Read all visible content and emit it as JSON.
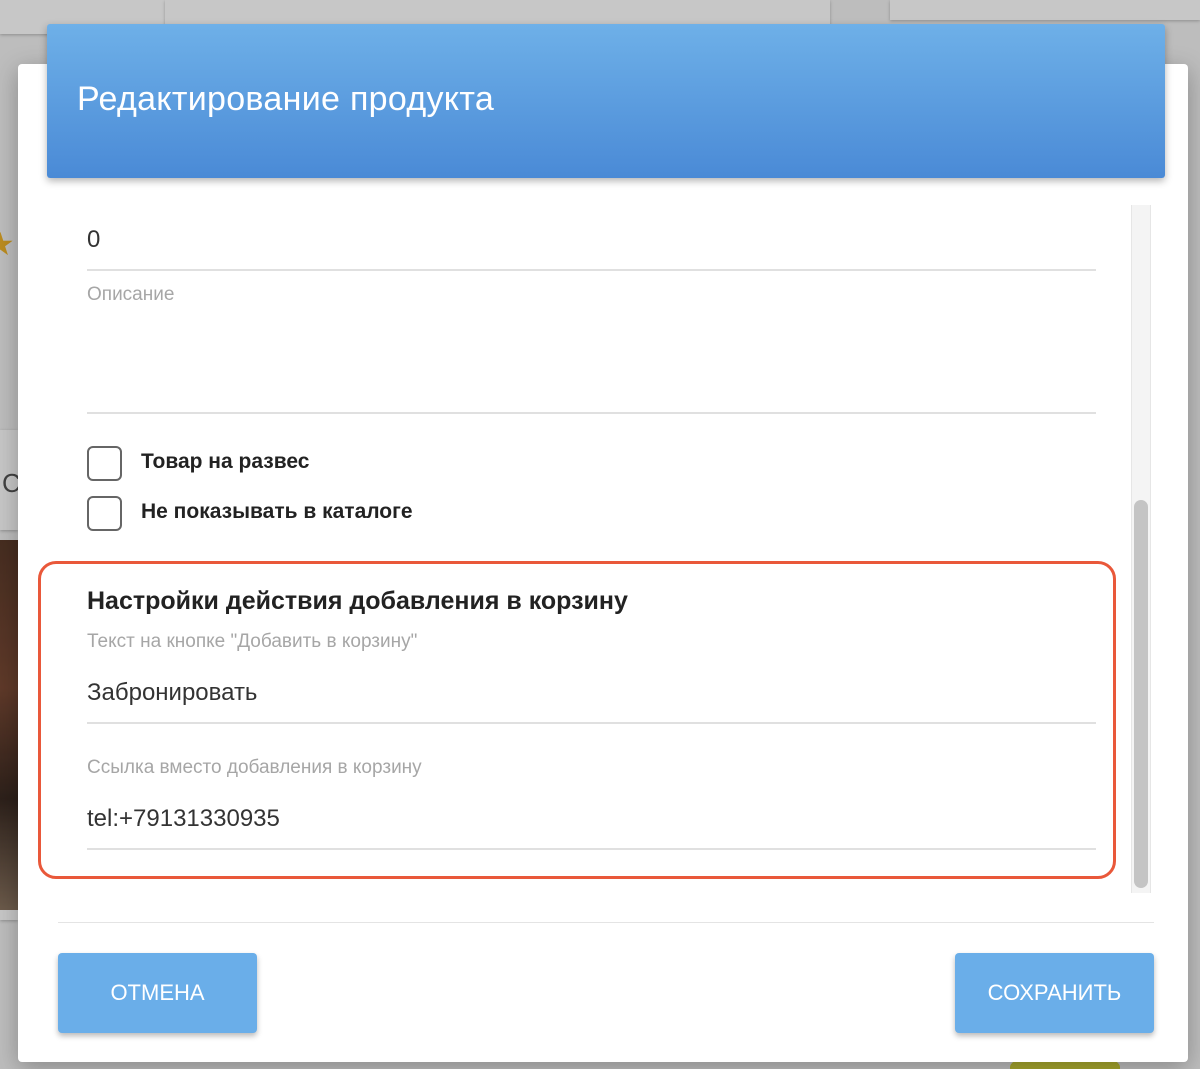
{
  "modal": {
    "title": "Редактирование продукта"
  },
  "form": {
    "quantity_value": "0",
    "description_label": "Описание",
    "description_value": "",
    "checkboxes": [
      {
        "label": "Товар на развес",
        "checked": false
      },
      {
        "label": "Не показывать в каталоге",
        "checked": false
      }
    ],
    "cart_settings": {
      "title": "Настройки действия добавления в корзину",
      "button_text_label": "Текст на кнопке \"Добавить в корзину\"",
      "button_text_value": "Забронировать",
      "link_label": "Ссылка вместо добавления в корзину",
      "link_value": "tel:+79131330935",
      "highlight_color": "#e9583a"
    }
  },
  "footer": {
    "cancel_label": "Отмена",
    "save_label": "Сохранить"
  },
  "colors": {
    "header_gradient_top": "#6eb0e8",
    "header_gradient_bottom": "#4a8ad6",
    "button_bg": "#6aaee9"
  },
  "background": {
    "partial_letter": "С",
    "icons": [
      "star-icon"
    ]
  }
}
